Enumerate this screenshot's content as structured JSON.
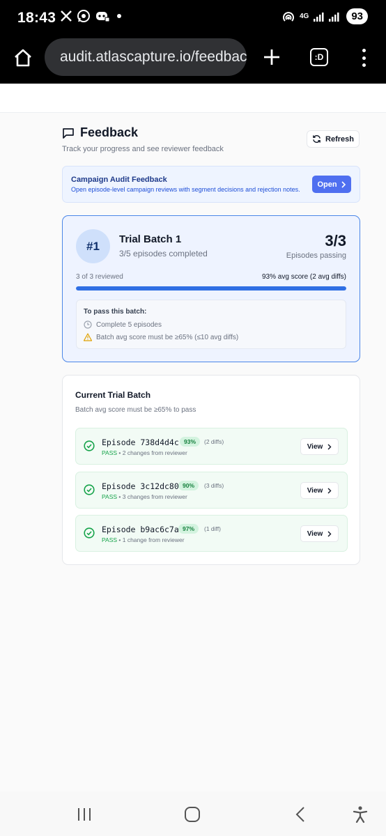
{
  "status_bar": {
    "time": "18:43",
    "network": "4G",
    "battery": "93",
    "icons": [
      "x-app-icon",
      "whatsapp-icon",
      "discord-icon",
      "hotspot-icon",
      "signal-icon"
    ]
  },
  "browser": {
    "url": "audit.atlascapture.io/feedback",
    "tab_label": ":D",
    "icons": [
      "home-icon",
      "site-settings-icon",
      "new-tab-icon",
      "tabs-icon",
      "overflow-menu-icon"
    ]
  },
  "header": {
    "title": "Feedback",
    "subtitle": "Track your progress and see reviewer feedback",
    "refresh_label": "Refresh"
  },
  "campaign": {
    "title": "Campaign Audit Feedback",
    "description": "Open episode-level campaign reviews with segment decisions and rejection notes.",
    "open_label": "Open"
  },
  "batch": {
    "number": "#1",
    "title": "Trial Batch 1",
    "subtitle": "3/5 episodes completed",
    "score": "3/3",
    "score_label": "Episodes passing",
    "reviewed": "3 of 3 reviewed",
    "avg": "93% avg score (2 avg diffs)",
    "progress": 1.0,
    "pass_title": "To pass this batch:",
    "req_episodes": "Complete 5 episodes",
    "req_score": "Batch avg score must be ≥65% (≤10 avg diffs)"
  },
  "current": {
    "title": "Current Trial Batch",
    "subtitle": "Batch avg score must be ≥65% to pass",
    "episodes": [
      {
        "name": "Episode 738d4d4c",
        "pct": "93%",
        "diffs": "(2 diffs)",
        "status": "PASS",
        "meta": " • 2 changes from reviewer",
        "view": "View"
      },
      {
        "name": "Episode 3c12dc80",
        "pct": "90%",
        "diffs": "(3 diffs)",
        "status": "PASS",
        "meta": " • 3 changes from reviewer",
        "view": "View"
      },
      {
        "name": "Episode b9ac6c7a",
        "pct": "97%",
        "diffs": "(1 diff)",
        "status": "PASS",
        "meta": " • 1 change from reviewer",
        "view": "View"
      }
    ]
  },
  "colors": {
    "accent": "#4f6ff0",
    "progress": "#2f6fe4",
    "pass_green": "#16a34a",
    "warning": "#e0a100"
  }
}
